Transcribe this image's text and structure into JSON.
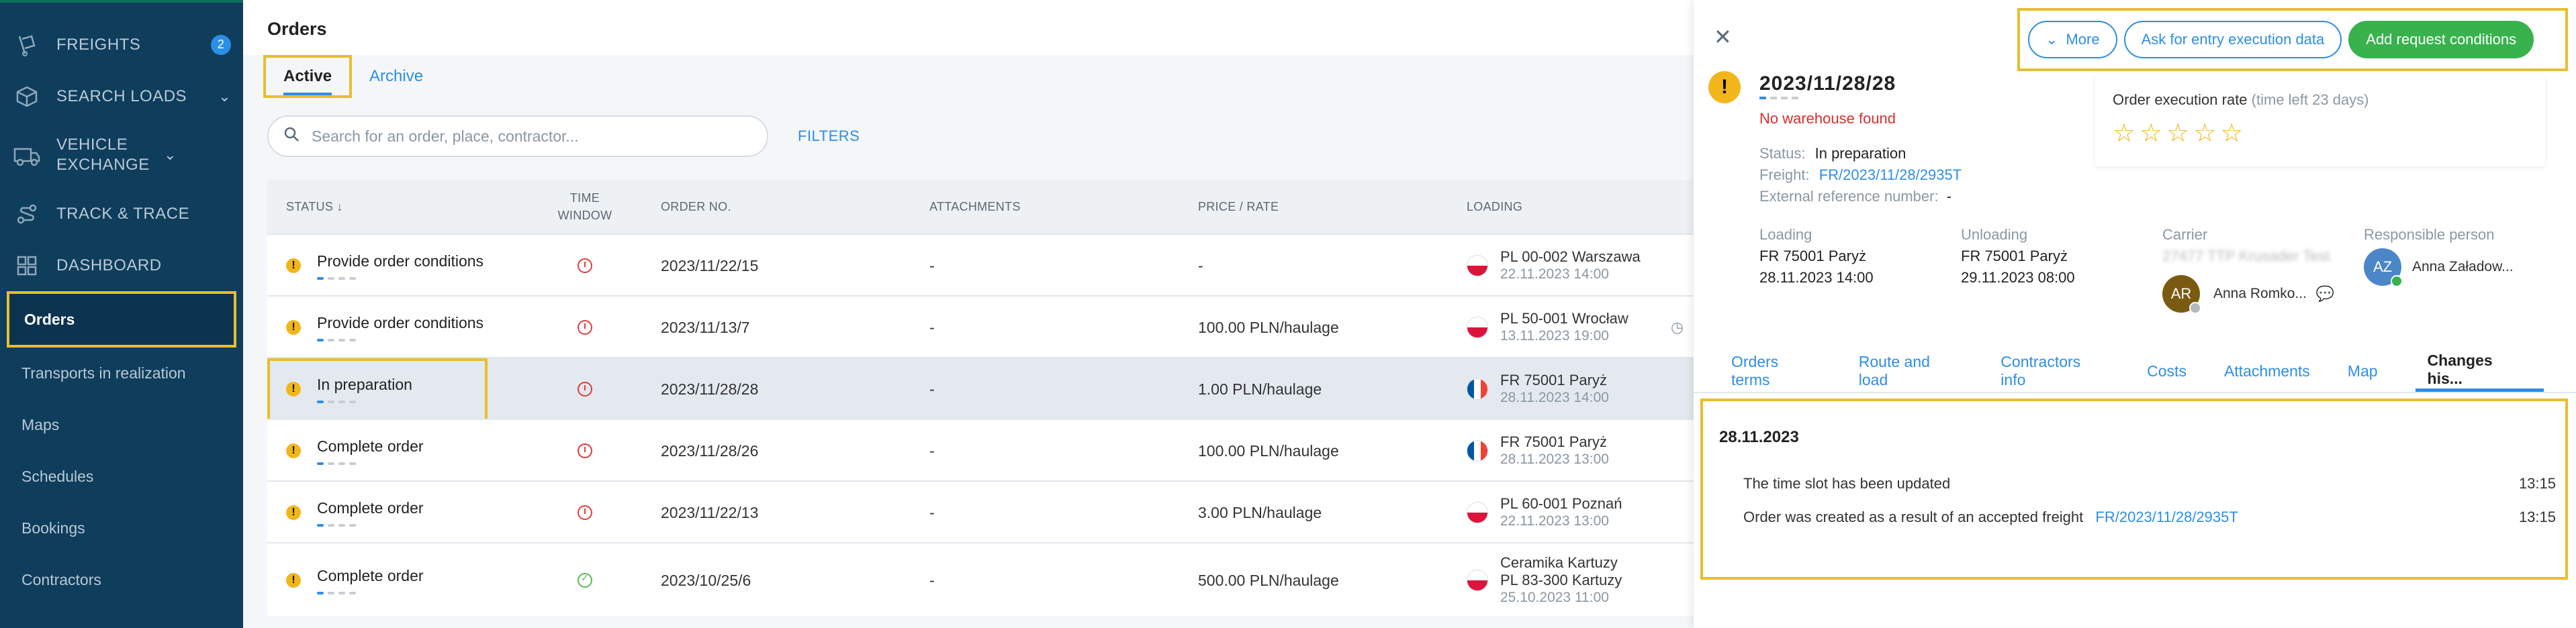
{
  "sidebar": {
    "items": [
      {
        "label": "FREIGHTS",
        "icon": "freights-icon",
        "badge": "2"
      },
      {
        "label": "SEARCH LOADS",
        "icon": "box-icon"
      },
      {
        "label": "VEHICLE EXCHANGE",
        "icon": "truck-icon"
      },
      {
        "label": "TRACK & TRACE",
        "icon": "route-icon"
      },
      {
        "label": "DASHBOARD",
        "icon": "dashboard-icon"
      }
    ],
    "subitems": [
      "Orders",
      "Transports in realization",
      "Maps",
      "Schedules",
      "Bookings",
      "Contractors"
    ]
  },
  "main": {
    "title": "Orders",
    "tabs": [
      "Active",
      "Archive"
    ],
    "search_placeholder": "Search for an order, place, contractor...",
    "filters_label": "FILTERS",
    "columns": {
      "status": "STATUS ↓",
      "time_window": "TIME WINDOW",
      "order_no": "ORDER NO.",
      "attachments": "ATTACHMENTS",
      "price": "PRICE / RATE",
      "loading": "LOADING"
    },
    "rows": [
      {
        "status": "Provide order conditions",
        "order_no": "2023/11/22/15",
        "attachments": "-",
        "price": "-",
        "flag": "pl",
        "loading_place": "PL 00-002 Warszawa",
        "loading_date": "22.11.2023 14:00",
        "time_ok": false
      },
      {
        "status": "Provide order conditions",
        "order_no": "2023/11/13/7",
        "attachments": "-",
        "price": "100.00 PLN/haulage",
        "flag": "pl",
        "loading_place": "PL 50-001 Wrocław",
        "loading_date": "13.11.2023 19:00",
        "time_ok": false
      },
      {
        "status": "In preparation",
        "order_no": "2023/11/28/28",
        "attachments": "-",
        "price": "1.00 PLN/haulage",
        "flag": "fr",
        "loading_place": "FR 75001 Paryż",
        "loading_date": "28.11.2023 14:00",
        "time_ok": false
      },
      {
        "status": "Complete order",
        "order_no": "2023/11/28/26",
        "attachments": "-",
        "price": "100.00 PLN/haulage",
        "flag": "fr",
        "loading_place": "FR 75001 Paryż",
        "loading_date": "28.11.2023 13:00",
        "time_ok": false
      },
      {
        "status": "Complete order",
        "order_no": "2023/11/22/13",
        "attachments": "-",
        "price": "3.00 PLN/haulage",
        "flag": "pl",
        "loading_place": "PL 60-001 Poznań",
        "loading_date": "22.11.2023 13:00",
        "time_ok": false
      },
      {
        "status": "Complete order",
        "order_no": "2023/10/25/6",
        "attachments": "-",
        "price": "500.00 PLN/haulage",
        "flag": "pl",
        "loading_company": "Ceramika Kartuzy",
        "loading_place": "PL 83-300 Kartuzy",
        "loading_date": "25.10.2023 11:00",
        "time_ok": true
      }
    ]
  },
  "panel": {
    "buttons": {
      "more": "More",
      "ask": "Ask for entry execution data",
      "add": "Add request conditions"
    },
    "order_no": "2023/11/28/28",
    "warning": "No warehouse found",
    "status_label": "Status:",
    "status_value": "In preparation",
    "freight_label": "Freight:",
    "freight_value": "FR/2023/11/28/2935T",
    "extref_label": "External reference number:",
    "extref_value": "-",
    "rate_title": "Order execution rate",
    "rate_time": "(time left 23 days)",
    "stars": "☆☆☆☆☆",
    "loading": {
      "label": "Loading",
      "place": "FR 75001 Paryż",
      "date": "28.11.2023 14:00"
    },
    "unloading": {
      "label": "Unloading",
      "place": "FR 75001 Paryż",
      "date": "29.11.2023 08:00"
    },
    "carrier": {
      "label": "Carrier",
      "name_blurred": "27477 TTP Krusader Test",
      "avatar": "AR",
      "person": "Anna Romko..."
    },
    "responsible": {
      "label": "Responsible person",
      "avatar": "AZ",
      "person": "Anna Załadow..."
    },
    "tabs": [
      "Orders terms",
      "Route and load",
      "Contractors info",
      "Costs",
      "Attachments",
      "Map",
      "Changes his..."
    ],
    "history": {
      "date": "28.11.2023",
      "entries": [
        {
          "text": "The time slot has been updated",
          "link": "",
          "time": "13:15"
        },
        {
          "text": "Order was created as a result of an accepted freight",
          "link": "FR/2023/11/28/2935T",
          "time": "13:15"
        }
      ]
    }
  }
}
